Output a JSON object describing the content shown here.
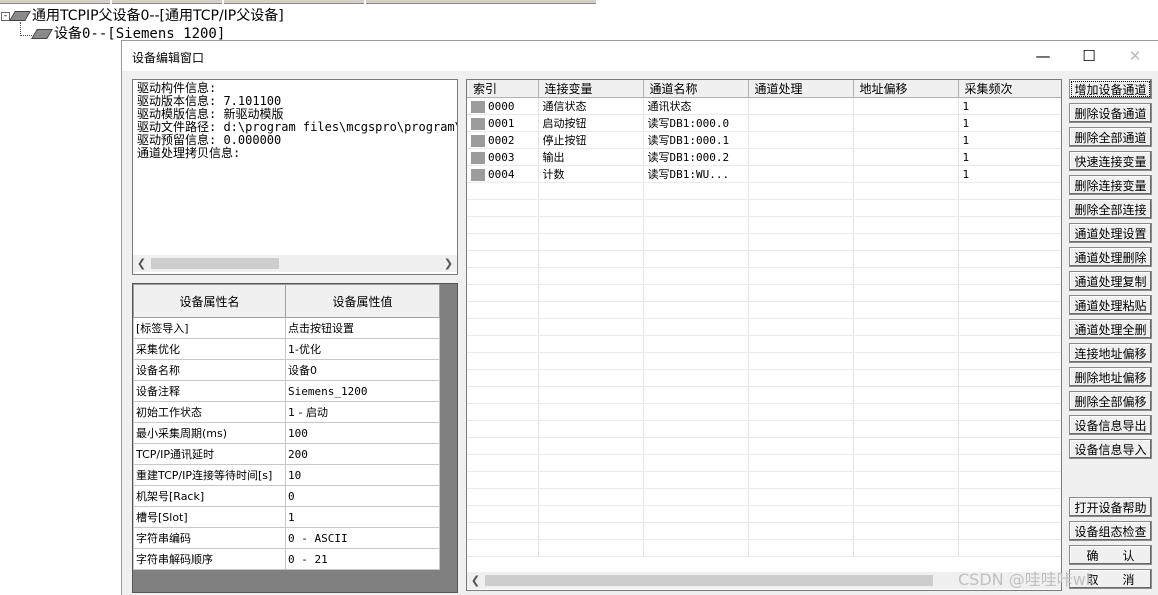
{
  "tree": {
    "parent_label": "通用TCPIP父设备0--[通用TCP/IP父设备]",
    "child_label": "设备0--[Siemens_1200]",
    "toggle": "-"
  },
  "dialog": {
    "title": "设备编辑窗口",
    "minimize": "—",
    "maximize": "☐",
    "close": "✕"
  },
  "info": {
    "lines": "驱动构件信息:\n驱动版本信息: 7.101100\n驱动模版信息: 新驱动模版\n驱动文件路径: d:\\program files\\mcgspro\\program\\\n驱动预留信息: 0.000000\n通道处理拷贝信息:"
  },
  "properties": {
    "headers": [
      "设备属性名",
      "设备属性值"
    ],
    "rows": [
      [
        "[标签导入]",
        "点击按钮设置"
      ],
      [
        "采集优化",
        "1-优化"
      ],
      [
        "设备名称",
        "设备0"
      ],
      [
        "设备注释",
        "Siemens_1200"
      ],
      [
        "初始工作状态",
        "1 - 启动"
      ],
      [
        "最小采集周期(ms)",
        "100"
      ],
      [
        "TCP/IP通讯延时",
        "200"
      ],
      [
        "重建TCP/IP连接等待时间[s]",
        "10"
      ],
      [
        "机架号[Rack]",
        "0"
      ],
      [
        "槽号[Slot]",
        "1"
      ],
      [
        "字符串编码",
        "0 - ASCII"
      ],
      [
        "字符串解码顺序",
        "0 - 21"
      ]
    ]
  },
  "channels": {
    "headers": [
      "索引",
      "连接变量",
      "通道名称",
      "通道处理",
      "地址偏移",
      "采集频次"
    ],
    "rows": [
      [
        "0000",
        "通信状态",
        "通讯状态",
        "",
        "",
        "1"
      ],
      [
        "0001",
        "启动按钮",
        "读写DB1:000.0",
        "",
        "",
        "1"
      ],
      [
        "0002",
        "停止按钮",
        "读写DB1:000.1",
        "",
        "",
        "1"
      ],
      [
        "0003",
        "输出",
        "读写DB1:000.2",
        "",
        "",
        "1"
      ],
      [
        "0004",
        "计数",
        "读写DB1:WU...",
        "",
        "",
        "1"
      ]
    ]
  },
  "buttons": {
    "top": [
      "增加设备通道",
      "删除设备通道",
      "删除全部通道",
      "快速连接变量",
      "删除连接变量",
      "删除全部连接",
      "通道处理设置",
      "通道处理删除",
      "通道处理复制",
      "通道处理粘贴",
      "通道处理全删",
      "连接地址偏移",
      "删除地址偏移",
      "删除全部偏移",
      "设备信息导出",
      "设备信息导入"
    ],
    "bottom": [
      "打开设备帮助",
      "设备组态检查",
      "确　　认",
      "取　　消"
    ]
  },
  "watermark": "CSDN @哇哇咔wk"
}
